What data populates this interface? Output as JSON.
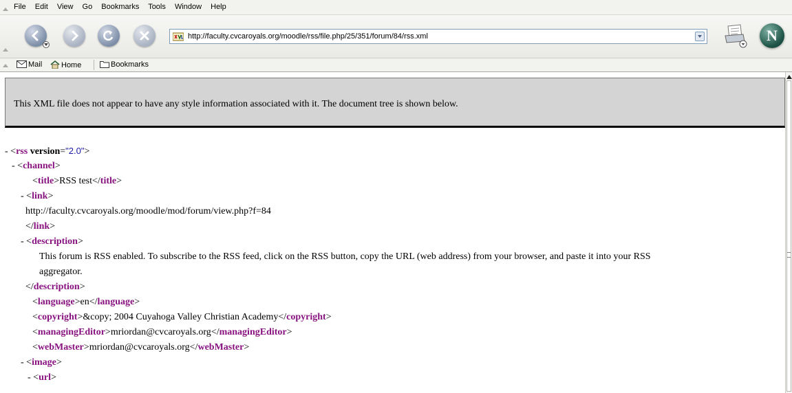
{
  "menu": {
    "items": [
      "File",
      "Edit",
      "View",
      "Go",
      "Bookmarks",
      "Tools",
      "Window",
      "Help"
    ]
  },
  "nav": {
    "back_icon": "back-arrow-icon",
    "forward_icon": "forward-arrow-icon",
    "reload_icon": "reload-icon",
    "stop_icon": "stop-x-icon",
    "url": "http://faculty.cvcaroyals.org/moodle/rss/file.php/25/351/forum/84/rss.xml"
  },
  "personal": {
    "mail": "Mail",
    "home": "Home",
    "bookmarks": "Bookmarks"
  },
  "page": {
    "banner": "This XML file does not appear to have any style information associated with it. The document tree is shown below."
  },
  "xml": {
    "rss_attr_name": "version",
    "rss_attr_value": "\"2.0\"",
    "title_text": "RSS test",
    "link_text": "http://faculty.cvcaroyals.org/moodle/mod/forum/view.php?f=84",
    "description_text_1": "This forum is RSS enabled. To subscribe to the RSS feed, click on the RSS button, copy the URL (web address) from your browser, and paste it into your RSS",
    "description_text_2": "aggregator.",
    "language_text": "en",
    "copyright_text": "&copy; 2004 Cuyahoga Valley Christian Academy",
    "managing_editor_text": "mriordan@cvcaroyals.org",
    "webmaster_text": "mriordan@cvcaroyals.org"
  },
  "colors": {
    "tag": "#881280",
    "attr_value": "#1a1aa6",
    "banner_bg": "#d4d4d4"
  }
}
